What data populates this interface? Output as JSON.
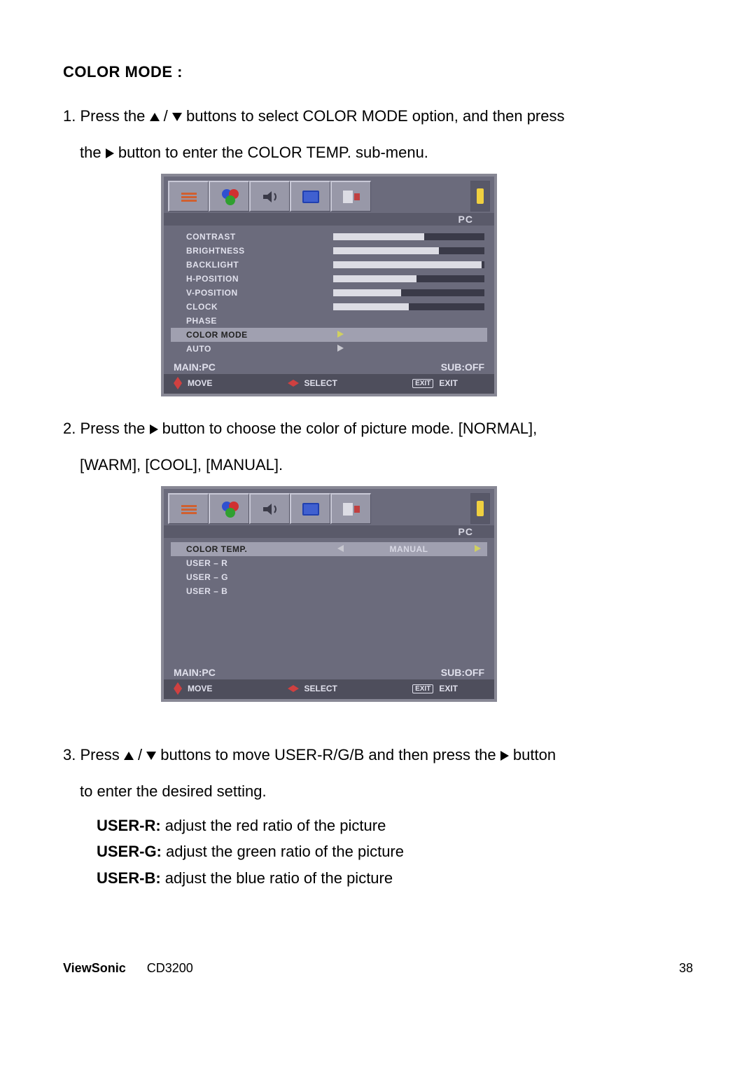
{
  "section_title": "COLOR MODE :",
  "step1a": "1. Press the ",
  "step1b": " / ",
  "step1c": " buttons to select COLOR MODE option, and then press",
  "step1d": "the ",
  "step1e": " button to enter the COLOR TEMP. sub-menu.",
  "step2a": "2. Press the ",
  "step2b": " button to choose the color of picture mode. [NORMAL],",
  "step2c": "[WARM], [COOL], [MANUAL].",
  "step3a": "3. Press ",
  "step3b": " / ",
  "step3c": " buttons to move USER-R/G/B and then press the ",
  "step3d": " button",
  "step3e": "to enter the desired setting.",
  "defs": {
    "r_label": "USER-R:",
    "r_text": " adjust the red ratio of the picture",
    "g_label": "USER-G:",
    "g_text": " adjust the green ratio of the picture",
    "b_label": "USER-B:",
    "b_text": " adjust the blue ratio of the picture"
  },
  "osd1": {
    "title": "PC",
    "items": [
      {
        "label": "CONTRAST",
        "fill": 60
      },
      {
        "label": "BRIGHTNESS",
        "fill": 70
      },
      {
        "label": "BACKLIGHT",
        "fill": 98
      },
      {
        "label": "H-POSITION",
        "fill": 55
      },
      {
        "label": "V-POSITION",
        "fill": 45
      },
      {
        "label": "CLOCK",
        "fill": 50
      },
      {
        "label": "PHASE",
        "fill": 0,
        "noslider": true
      },
      {
        "label": "COLOR   MODE",
        "arrow": true,
        "highlight": true,
        "yellow": true
      },
      {
        "label": "AUTO",
        "arrow": true
      }
    ],
    "main": "MAIN:PC",
    "sub": "SUB:OFF",
    "move": "MOVE",
    "select": "SELECT",
    "exitbox": "EXIT",
    "exit": "EXIT"
  },
  "osd2": {
    "title": "PC",
    "items": [
      {
        "label": "COLOR   TEMP.",
        "leftarrow": true,
        "value": "MANUAL",
        "rightarrow": true,
        "highlight": true,
        "yellow": true
      },
      {
        "label": "USER – R"
      },
      {
        "label": "USER – G"
      },
      {
        "label": "USER – B"
      }
    ],
    "main": "MAIN:PC",
    "sub": "SUB:OFF",
    "move": "MOVE",
    "select": "SELECT",
    "exitbox": "EXIT",
    "exit": "EXIT"
  },
  "footer": {
    "brand": "ViewSonic",
    "model": "CD3200",
    "page": "38"
  }
}
